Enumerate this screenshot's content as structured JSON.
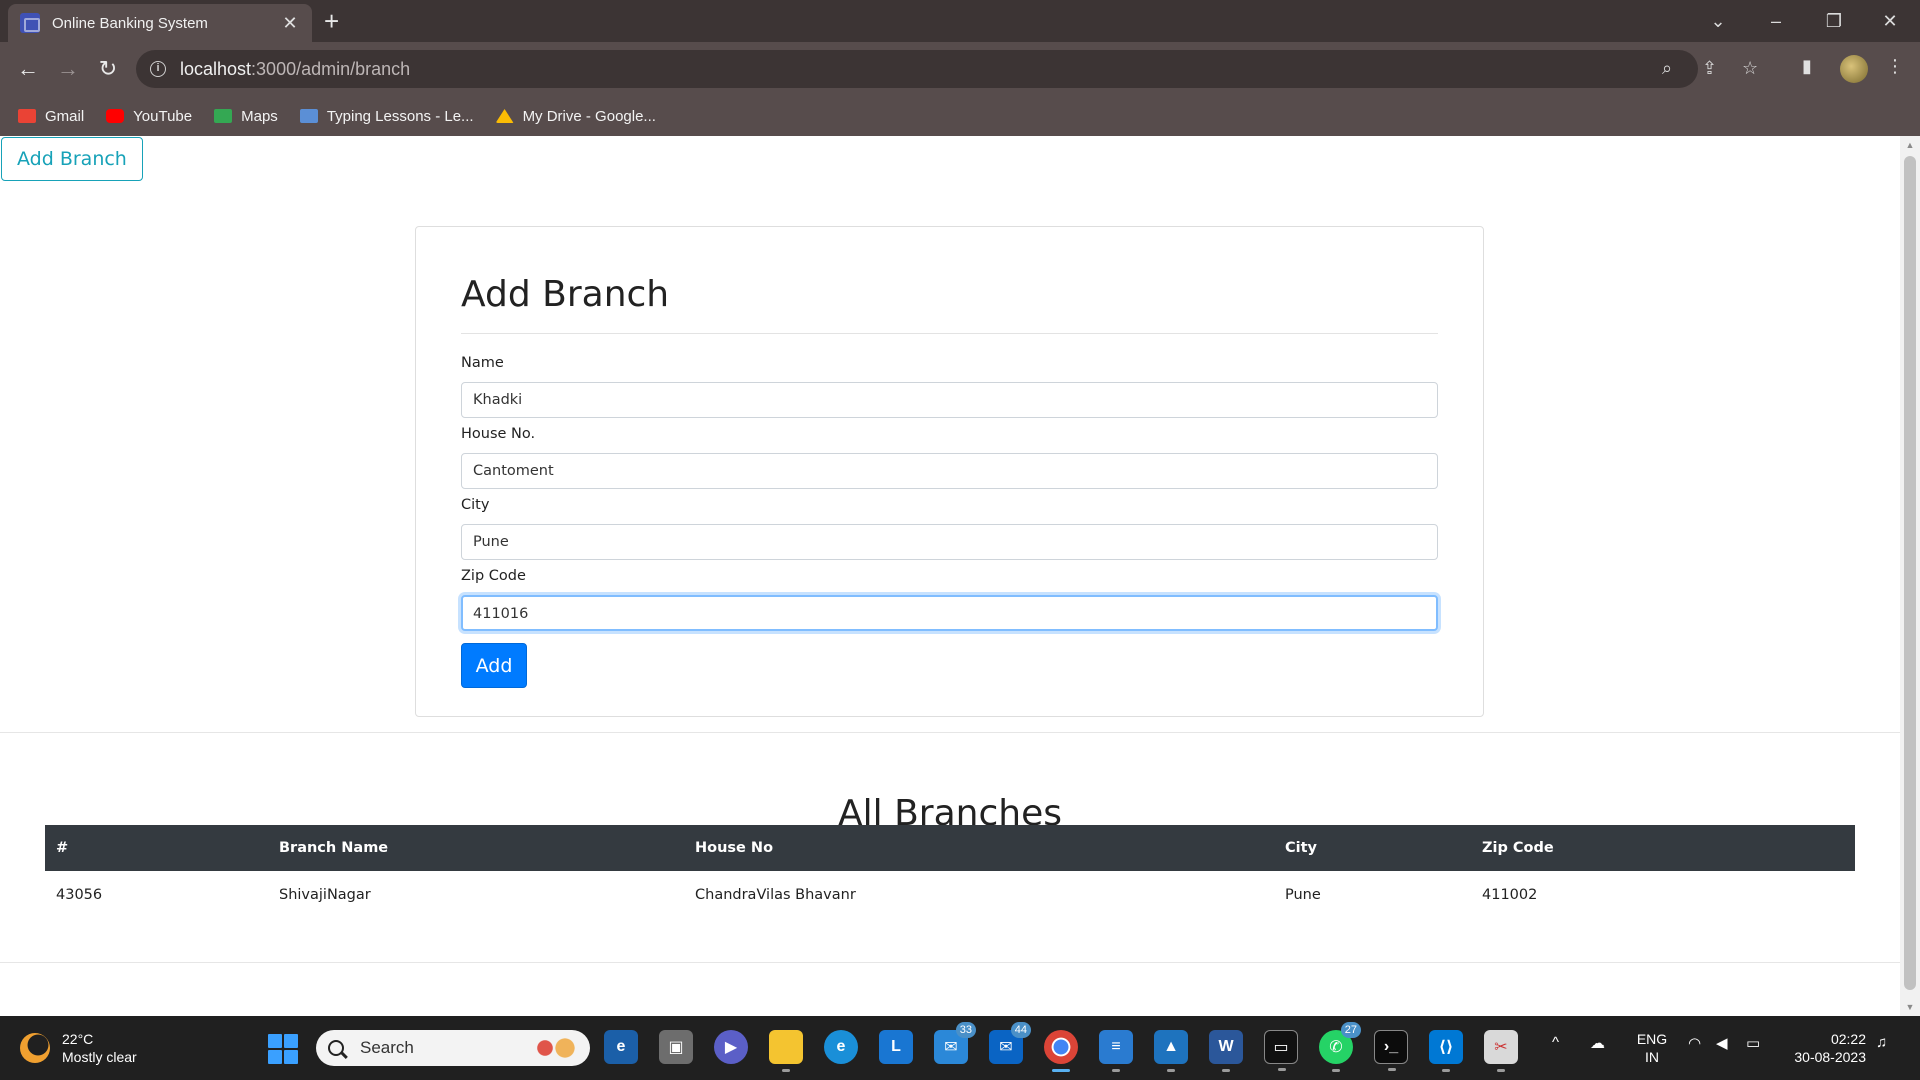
{
  "browser": {
    "tab_title": "Online Banking System",
    "tab_close": "✕",
    "new_tab": "+",
    "url_host": "localhost",
    "url_path": ":3000/admin/branch",
    "bookmarks": [
      {
        "label": "Gmail",
        "icon": "gmail-icon",
        "color": "#ea4335"
      },
      {
        "label": "YouTube",
        "icon": "youtube-icon",
        "color": "#ff0000"
      },
      {
        "label": "Maps",
        "icon": "maps-icon",
        "color": "#34a853"
      },
      {
        "label": "Typing Lessons - Le...",
        "icon": "typing-icon",
        "color": "#5b8fd6"
      },
      {
        "label": "My Drive - Google...",
        "icon": "drive-icon",
        "color": "#fbbc04"
      }
    ]
  },
  "page": {
    "top_button": "Add Branch",
    "form": {
      "title": "Add Branch",
      "fields": [
        {
          "label": "Name",
          "value": "Khadki"
        },
        {
          "label": "House No.",
          "value": "Cantoment"
        },
        {
          "label": "City",
          "value": "Pune"
        },
        {
          "label": "Zip Code",
          "value": "411016"
        }
      ],
      "submit_label": "Add"
    },
    "table": {
      "title": "All Branches",
      "headers": [
        "#",
        "Branch Name",
        "House No",
        "City",
        "Zip Code"
      ],
      "rows": [
        [
          "43056",
          "ShivajiNagar",
          "ChandraVilas Bhavanr",
          "Pune",
          "411002"
        ]
      ]
    }
  },
  "taskbar": {
    "temperature": "22°C",
    "weather": "Mostly clear",
    "search_placeholder": "Search",
    "badges": {
      "mail": "33",
      "outlook": "44",
      "whatsapp": "27"
    },
    "lang_1": "ENG",
    "lang_2": "IN",
    "time": "02:22",
    "date": "30-08-2023"
  },
  "colors": {
    "accent": "#007bff",
    "outline_button": "#17a2b8",
    "table_header": "#343a40",
    "chrome_dark": "#3c3434",
    "chrome": "#574c4c"
  }
}
